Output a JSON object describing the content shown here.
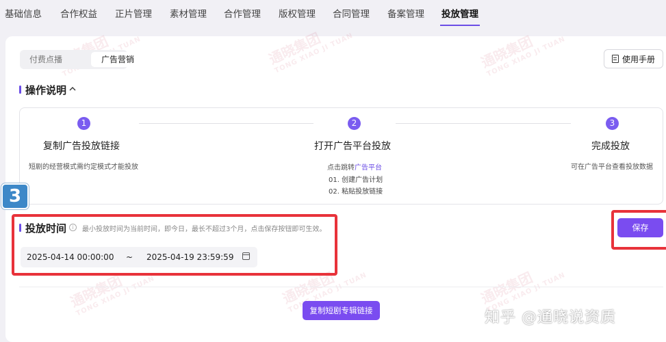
{
  "nav": {
    "items": [
      "基础信息",
      "合作权益",
      "正片管理",
      "素材管理",
      "合作管理",
      "版权管理",
      "合同管理",
      "备案管理",
      "投放管理"
    ],
    "active_index": 8
  },
  "segment": {
    "options": [
      "付费点播",
      "广告营销"
    ],
    "selected": "广告营销"
  },
  "manual_button": {
    "label": "使用手册",
    "icon": "document-icon"
  },
  "instructions": {
    "title": "操作说明",
    "toggle_icon": "chevron-up-icon",
    "steps": [
      {
        "num": "1",
        "title": "复制广告投放链接",
        "desc": "短剧的经营模式需约定模式才能投放"
      },
      {
        "num": "2",
        "title": "打开广告平台投放",
        "desc_prefix": "点击跳转",
        "desc_link": "广告平台",
        "sub1": "01. 创建广告计划",
        "sub2": "02. 粘贴投放链接"
      },
      {
        "num": "3",
        "title": "完成投放",
        "desc": "可在广告平台查看投放数据"
      }
    ]
  },
  "annotation_badge": "3",
  "placement_time": {
    "title": "投放时间",
    "hint": "最小投放时间为当前时间，即今日，最长不超过3个月，点击保存按钮即可生效。",
    "start": "2025-04-14 00:00:00",
    "separator": "~",
    "end": "2025-04-19 23:59:59",
    "icon": "calendar-icon"
  },
  "save_button": "保存",
  "copy_button": "复制短剧专辑链接",
  "watermark": {
    "bg_text": "通晓集团",
    "bg_sub": "TONG XIAO JI TUAN",
    "corner": "知乎 @通晓说资质"
  },
  "colors": {
    "accent": "#7a4cf0",
    "highlight": "#e8323a",
    "badge": "#3d88c8"
  }
}
